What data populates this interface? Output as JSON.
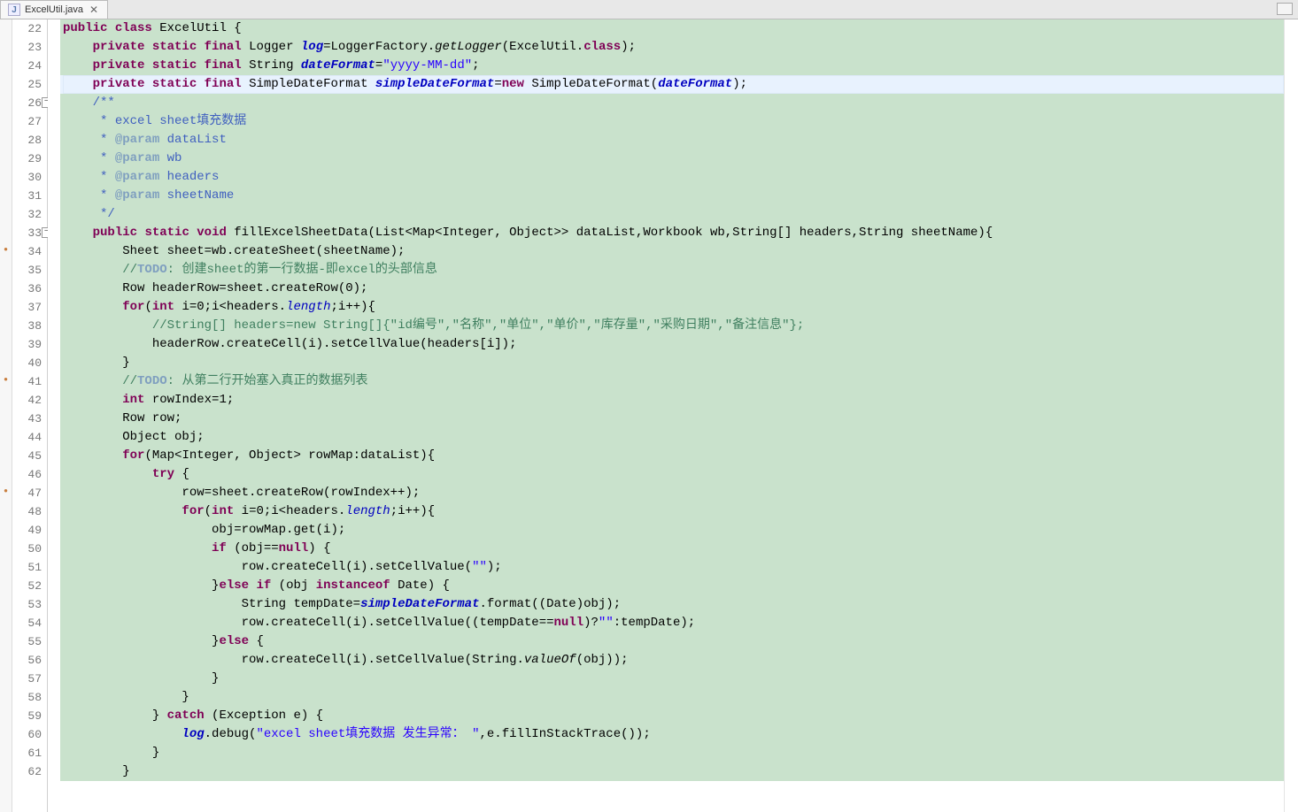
{
  "tab": {
    "filename": "ExcelUtil.java"
  },
  "lineStart": 22,
  "foldableLines": [
    26,
    33
  ],
  "dotMarkers": [
    34,
    41,
    47
  ],
  "highlightLine": 25,
  "code": [
    [
      [
        "kw",
        "public"
      ],
      [
        "",
        " "
      ],
      [
        "kw",
        "class"
      ],
      [
        "",
        " ExcelUtil {"
      ]
    ],
    [
      [
        "",
        "    "
      ],
      [
        "kw",
        "private"
      ],
      [
        "",
        " "
      ],
      [
        "kw",
        "static"
      ],
      [
        "",
        " "
      ],
      [
        "kw",
        "final"
      ],
      [
        "",
        " Logger "
      ],
      [
        "fld",
        "log"
      ],
      [
        "",
        "=LoggerFactory."
      ],
      [
        "stat",
        "getLogger"
      ],
      [
        "",
        "(ExcelUtil."
      ],
      [
        "kw",
        "class"
      ],
      [
        "",
        ");"
      ]
    ],
    [
      [
        "",
        "    "
      ],
      [
        "kw",
        "private"
      ],
      [
        "",
        " "
      ],
      [
        "kw",
        "static"
      ],
      [
        "",
        " "
      ],
      [
        "kw",
        "final"
      ],
      [
        "",
        " String "
      ],
      [
        "fld",
        "dateFormat"
      ],
      [
        "",
        "="
      ],
      [
        "str",
        "\"yyyy-MM-dd\""
      ],
      [
        "",
        ";"
      ]
    ],
    [
      [
        "",
        "    "
      ],
      [
        "kw",
        "private"
      ],
      [
        "",
        " "
      ],
      [
        "kw",
        "static"
      ],
      [
        "",
        " "
      ],
      [
        "kw",
        "final"
      ],
      [
        "",
        " SimpleDateFormat "
      ],
      [
        "fld",
        "simpleDateFormat"
      ],
      [
        "",
        "="
      ],
      [
        "kw",
        "new"
      ],
      [
        "",
        " SimpleDateFormat("
      ],
      [
        "fld",
        "dateFormat"
      ],
      [
        "",
        ");"
      ]
    ],
    [
      [
        "",
        "    "
      ],
      [
        "jdoc",
        "/**"
      ]
    ],
    [
      [
        "",
        "     "
      ],
      [
        "jdoc",
        "* excel sheet填充数据"
      ]
    ],
    [
      [
        "",
        "     "
      ],
      [
        "jdoc",
        "* "
      ],
      [
        "jtag",
        "@param"
      ],
      [
        "jdoc",
        " dataList"
      ]
    ],
    [
      [
        "",
        "     "
      ],
      [
        "jdoc",
        "* "
      ],
      [
        "jtag",
        "@param"
      ],
      [
        "jdoc",
        " wb"
      ]
    ],
    [
      [
        "",
        "     "
      ],
      [
        "jdoc",
        "* "
      ],
      [
        "jtag",
        "@param"
      ],
      [
        "jdoc",
        " headers"
      ]
    ],
    [
      [
        "",
        "     "
      ],
      [
        "jdoc",
        "* "
      ],
      [
        "jtag",
        "@param"
      ],
      [
        "jdoc",
        " sheetName"
      ]
    ],
    [
      [
        "",
        "     "
      ],
      [
        "jdoc",
        "*/"
      ]
    ],
    [
      [
        "",
        "    "
      ],
      [
        "kw",
        "public"
      ],
      [
        "",
        " "
      ],
      [
        "kw",
        "static"
      ],
      [
        "",
        " "
      ],
      [
        "kw",
        "void"
      ],
      [
        "",
        " fillExcelSheetData(List<Map<Integer, Object>> dataList,Workbook wb,String[] headers,String sheetName){"
      ]
    ],
    [
      [
        "",
        "        Sheet sheet=wb.createSheet(sheetName);"
      ]
    ],
    [
      [
        "",
        "        "
      ],
      [
        "cmt",
        "//"
      ],
      [
        "todo",
        "TODO"
      ],
      [
        "cmt",
        ": 创建sheet的第一行数据-即excel的头部信息"
      ]
    ],
    [
      [
        "",
        "        Row headerRow=sheet.createRow(0);"
      ]
    ],
    [
      [
        "",
        "        "
      ],
      [
        "kw",
        "for"
      ],
      [
        "",
        "("
      ],
      [
        "kw",
        "int"
      ],
      [
        "",
        " i=0;i<headers."
      ],
      [
        "fld2",
        "length"
      ],
      [
        "",
        ";i++){"
      ]
    ],
    [
      [
        "",
        "            "
      ],
      [
        "cmt",
        "//String[] headers=new String[]{\"id编号\",\"名称\",\"单位\",\"单价\",\"库存量\",\"采购日期\",\"备注信息\"};"
      ]
    ],
    [
      [
        "",
        "            headerRow.createCell(i).setCellValue(headers[i]);"
      ]
    ],
    [
      [
        "",
        "        }"
      ]
    ],
    [
      [
        "",
        "        "
      ],
      [
        "cmt",
        "//"
      ],
      [
        "todo",
        "TODO"
      ],
      [
        "cmt",
        ": 从第二行开始塞入真正的数据列表"
      ]
    ],
    [
      [
        "",
        "        "
      ],
      [
        "kw",
        "int"
      ],
      [
        "",
        " rowIndex=1;"
      ]
    ],
    [
      [
        "",
        "        Row row;"
      ]
    ],
    [
      [
        "",
        "        Object obj;"
      ]
    ],
    [
      [
        "",
        "        "
      ],
      [
        "kw",
        "for"
      ],
      [
        "",
        "(Map<Integer, Object> rowMap:dataList){"
      ]
    ],
    [
      [
        "",
        "            "
      ],
      [
        "kw",
        "try"
      ],
      [
        "",
        " {"
      ]
    ],
    [
      [
        "",
        "                row=sheet.createRow(rowIndex++);"
      ]
    ],
    [
      [
        "",
        "                "
      ],
      [
        "kw",
        "for"
      ],
      [
        "",
        "("
      ],
      [
        "kw",
        "int"
      ],
      [
        "",
        " i=0;i<headers."
      ],
      [
        "fld2",
        "length"
      ],
      [
        "",
        ";i++){"
      ]
    ],
    [
      [
        "",
        "                    obj=rowMap.get(i);"
      ]
    ],
    [
      [
        "",
        "                    "
      ],
      [
        "kw",
        "if"
      ],
      [
        "",
        " (obj=="
      ],
      [
        "kw",
        "null"
      ],
      [
        "",
        ") {"
      ]
    ],
    [
      [
        "",
        "                        row.createCell(i).setCellValue("
      ],
      [
        "str",
        "\"\""
      ],
      [
        "",
        ");"
      ]
    ],
    [
      [
        "",
        "                    }"
      ],
      [
        "kw",
        "else"
      ],
      [
        "",
        " "
      ],
      [
        "kw",
        "if"
      ],
      [
        "",
        " (obj "
      ],
      [
        "kw",
        "instanceof"
      ],
      [
        "",
        " Date) {"
      ]
    ],
    [
      [
        "",
        "                        String tempDate="
      ],
      [
        "fld",
        "simpleDateFormat"
      ],
      [
        "",
        ".format((Date)obj);"
      ]
    ],
    [
      [
        "",
        "                        row.createCell(i).setCellValue((tempDate=="
      ],
      [
        "kw",
        "null"
      ],
      [
        "",
        ")?"
      ],
      [
        "str",
        "\"\""
      ],
      [
        "",
        ":tempDate);"
      ]
    ],
    [
      [
        "",
        "                    }"
      ],
      [
        "kw",
        "else"
      ],
      [
        "",
        " {"
      ]
    ],
    [
      [
        "",
        "                        row.createCell(i).setCellValue(String."
      ],
      [
        "stat",
        "valueOf"
      ],
      [
        "",
        "(obj));"
      ]
    ],
    [
      [
        "",
        "                    }"
      ]
    ],
    [
      [
        "",
        "                }"
      ]
    ],
    [
      [
        "",
        "            } "
      ],
      [
        "kw",
        "catch"
      ],
      [
        "",
        " (Exception e) {"
      ]
    ],
    [
      [
        "",
        "                "
      ],
      [
        "fld",
        "log"
      ],
      [
        "",
        ".debug("
      ],
      [
        "str",
        "\"excel sheet填充数据 发生异常： \""
      ],
      [
        "",
        ",e.fillInStackTrace());"
      ]
    ],
    [
      [
        "",
        "            }"
      ]
    ],
    [
      [
        "",
        "        }"
      ]
    ]
  ]
}
